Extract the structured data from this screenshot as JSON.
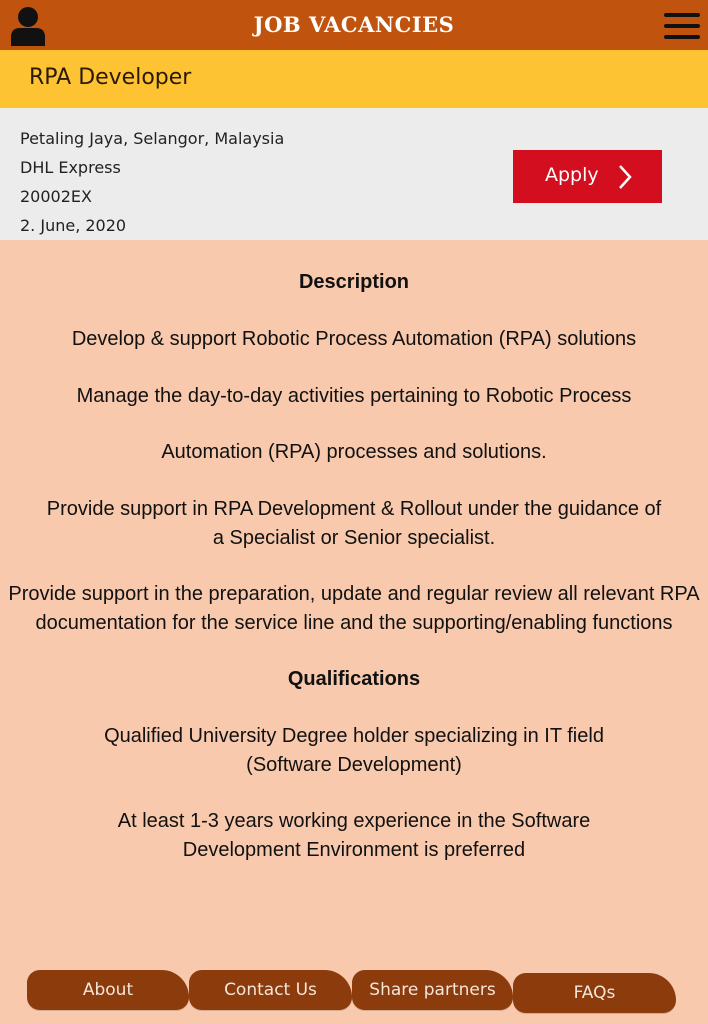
{
  "app": {
    "title": "JOB VACANCIES"
  },
  "job": {
    "title": "RPA Developer",
    "location": "Petaling Jaya, Selangor, Malaysia",
    "company": "DHL Express",
    "reference": "20002EX",
    "date": "2. June, 2020",
    "apply_label": "Apply"
  },
  "description": {
    "heading": "Description",
    "items": [
      "Develop & support Robotic Process Automation (RPA) solutions",
      "Manage the day-to-day activities pertaining to Robotic Process",
      "Automation (RPA) processes and solutions.",
      "Provide support in RPA Development & Rollout under the guidance of a Specialist or Senior specialist.",
      "Provide support in the preparation, update and regular review all relevant RPA documentation for the service line and the supporting/enabling functions"
    ]
  },
  "qualifications": {
    "heading": "Qualifications",
    "items": [
      "Qualified University Degree holder specializing in IT field (Software Development)",
      "At least 1-3 years working experience in the Software Development Environment is preferred"
    ]
  },
  "nav": {
    "about": "About",
    "contact": "Contact Us",
    "share": "Share partners",
    "faqs": "FAQs"
  },
  "colors": {
    "topbar": "#c0540f",
    "job_header": "#fec332",
    "info_panel": "#ececec",
    "content_bg": "#f8c9ac",
    "apply_button": "#d30e1e",
    "nav_tab": "#8b3b0c"
  },
  "icons": {
    "user": "user-icon",
    "menu": "hamburger-menu-icon",
    "apply": "chevron-right-icon"
  }
}
